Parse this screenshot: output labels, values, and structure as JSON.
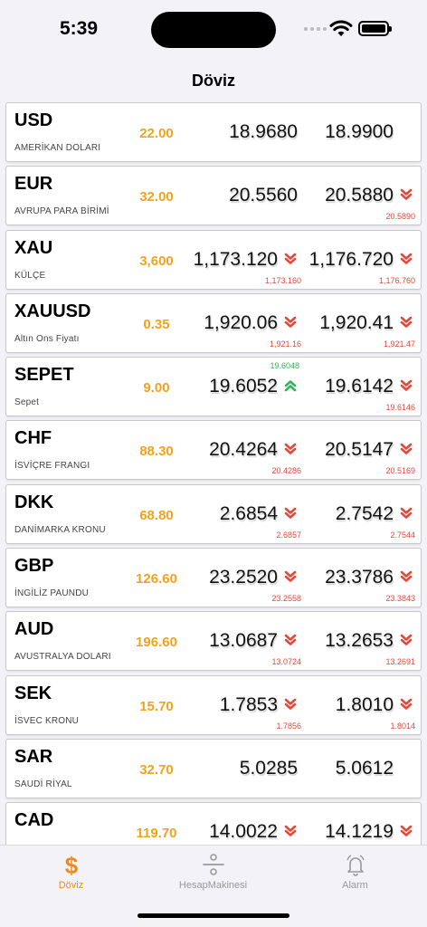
{
  "status": {
    "time": "5:39"
  },
  "nav": {
    "title": "Döviz"
  },
  "rates": [
    {
      "code": "USD",
      "name": "AMERİKAN DOLARI",
      "change": "22.00",
      "buy": "18.9680",
      "sell": "18.9900",
      "buy_trend": "none",
      "sell_trend": "none",
      "buy_prev": "",
      "sell_prev": ""
    },
    {
      "code": "EUR",
      "name": "AVRUPA PARA BİRİMİ",
      "change": "32.00",
      "buy": "20.5560",
      "sell": "20.5880",
      "buy_trend": "none",
      "sell_trend": "down",
      "buy_prev": "",
      "sell_prev": "20.5890"
    },
    {
      "code": "XAU",
      "name": "KÜLÇE",
      "change": "3,600",
      "buy": "1,173.120",
      "sell": "1,176.720",
      "buy_trend": "down",
      "sell_trend": "down",
      "buy_prev": "1,173.160",
      "sell_prev": "1,176.760"
    },
    {
      "code": "XAUUSD",
      "name": "Altın Ons Fiyatı",
      "change": "0.35",
      "buy": "1,920.06",
      "sell": "1,920.41",
      "buy_trend": "down",
      "sell_trend": "down",
      "buy_prev": "1,921.16",
      "sell_prev": "1,921.47"
    },
    {
      "code": "SEPET",
      "name": "Sepet",
      "change": "9.00",
      "buy": "19.6052",
      "sell": "19.6142",
      "buy_trend": "up",
      "sell_trend": "down",
      "buy_prev": "19.6048",
      "sell_prev": "19.6146"
    },
    {
      "code": "CHF",
      "name": "İSVİÇRE FRANGI",
      "change": "88.30",
      "buy": "20.4264",
      "sell": "20.5147",
      "buy_trend": "down",
      "sell_trend": "down",
      "buy_prev": "20.4286",
      "sell_prev": "20.5169"
    },
    {
      "code": "DKK",
      "name": "DANİMARKA KRONU",
      "change": "68.80",
      "buy": "2.6854",
      "sell": "2.7542",
      "buy_trend": "down",
      "sell_trend": "down",
      "buy_prev": "2.6857",
      "sell_prev": "2.7544"
    },
    {
      "code": "GBP",
      "name": "İNGİLİZ PAUNDU",
      "change": "126.60",
      "buy": "23.2520",
      "sell": "23.3786",
      "buy_trend": "down",
      "sell_trend": "down",
      "buy_prev": "23.2558",
      "sell_prev": "23.3843"
    },
    {
      "code": "AUD",
      "name": "AVUSTRALYA DOLARI",
      "change": "196.60",
      "buy": "13.0687",
      "sell": "13.2653",
      "buy_trend": "down",
      "sell_trend": "down",
      "buy_prev": "13.0724",
      "sell_prev": "13.2691"
    },
    {
      "code": "SEK",
      "name": "İSVEC KRONU",
      "change": "15.70",
      "buy": "1.7853",
      "sell": "1.8010",
      "buy_trend": "down",
      "sell_trend": "down",
      "buy_prev": "1.7856",
      "sell_prev": "1.8014"
    },
    {
      "code": "SAR",
      "name": "SAUDİ RİYAL",
      "change": "32.70",
      "buy": "5.0285",
      "sell": "5.0612",
      "buy_trend": "none",
      "sell_trend": "none",
      "buy_prev": "",
      "sell_prev": ""
    },
    {
      "code": "CAD",
      "name": "",
      "change": "119.70",
      "buy": "14.0022",
      "sell": "14.1219",
      "buy_trend": "down",
      "sell_trend": "down",
      "buy_prev": "",
      "sell_prev": ""
    }
  ],
  "tabs": [
    {
      "label": "Döviz",
      "icon": "dollar-icon",
      "active": true
    },
    {
      "label": "HesapMakinesi",
      "icon": "divide-icon",
      "active": false
    },
    {
      "label": "Alarm",
      "icon": "bell-icon",
      "active": false
    }
  ],
  "colors": {
    "accent": "#f0891b",
    "change": "#f5a21b",
    "down": "#e04a3a",
    "up": "#34b35a"
  }
}
